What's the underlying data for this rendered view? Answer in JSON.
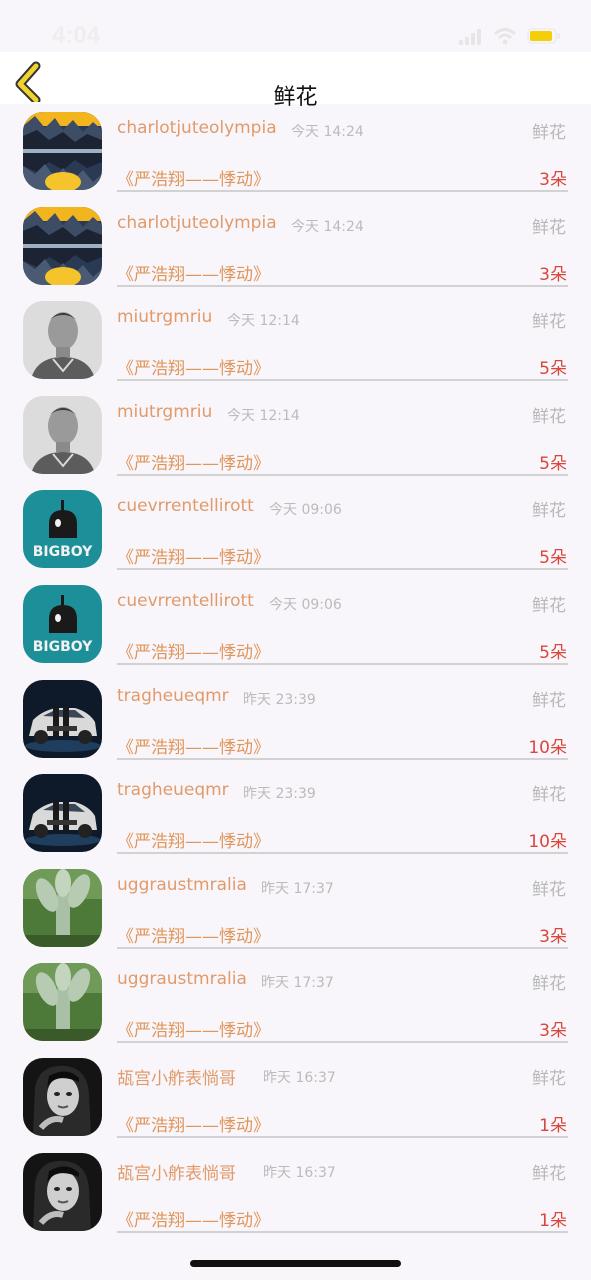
{
  "status_bar": {
    "time": "4:04"
  },
  "header": {
    "title": "鲜花"
  },
  "rows": [
    {
      "avatar": "landscape-avatar",
      "name": "charlotjuteolympia",
      "time": "今天 14:24",
      "gift": "鲜花",
      "song": "《严浩翔——悸动》",
      "count": "3朵"
    },
    {
      "avatar": "landscape-avatar",
      "name": "charlotjuteolympia",
      "time": "今天 14:24",
      "gift": "鲜花",
      "song": "《严浩翔——悸动》",
      "count": "3朵"
    },
    {
      "avatar": "man-portrait-avatar",
      "name": "miutrgmriu",
      "time": "今天 12:14",
      "gift": "鲜花",
      "song": "《严浩翔——悸动》",
      "count": "5朵"
    },
    {
      "avatar": "man-portrait-avatar",
      "name": "miutrgmriu",
      "time": "今天 12:14",
      "gift": "鲜花",
      "song": "《严浩翔——悸动》",
      "count": "5朵"
    },
    {
      "avatar": "bigboy-logo-avatar",
      "name": "cuevrrentellirott",
      "time": "今天 09:06",
      "gift": "鲜花",
      "song": "《严浩翔——悸动》",
      "count": "5朵"
    },
    {
      "avatar": "bigboy-logo-avatar",
      "name": "cuevrrentellirott",
      "time": "今天 09:06",
      "gift": "鲜花",
      "song": "《严浩翔——悸动》",
      "count": "5朵"
    },
    {
      "avatar": "car-avatar",
      "name": "tragheueqmr",
      "time": "昨天 23:39",
      "gift": "鲜花",
      "song": "《严浩翔——悸动》",
      "count": "10朵"
    },
    {
      "avatar": "car-avatar",
      "name": "tragheueqmr",
      "time": "昨天 23:39",
      "gift": "鲜花",
      "song": "《严浩翔——悸动》",
      "count": "10朵"
    },
    {
      "avatar": "cactus-avatar",
      "name": "uggraustmralia",
      "time": "昨天 17:37",
      "gift": "鲜花",
      "song": "《严浩翔——悸动》",
      "count": "3朵"
    },
    {
      "avatar": "cactus-avatar",
      "name": "uggraustmralia",
      "time": "昨天 17:37",
      "gift": "鲜花",
      "song": "《严浩翔——悸动》",
      "count": "3朵"
    },
    {
      "avatar": "woman-portrait-avatar",
      "name": "瓳宫小舴表惝哥",
      "time": "昨天 16:37",
      "gift": "鲜花",
      "song": "《严浩翔——悸动》",
      "count": "1朵"
    },
    {
      "avatar": "woman-portrait-avatar",
      "name": "瓳宫小舴表惝哥",
      "time": "昨天 16:37",
      "gift": "鲜花",
      "song": "《严浩翔——悸动》",
      "count": "1朵"
    }
  ],
  "avatar_art": {
    "landscape-avatar": "<svg viewBox='0 0 79 78'><rect width='79' height='78' fill='#2a3a55'/><rect x='0' y='0' width='79' height='14' fill='#f3b51e'/><polygon points='0,14 12,4 22,16 32,6 40,18 50,8 60,20 70,10 79,18 79,38 0,38' fill='#3d4d66'/><polygon points='0,24 14,18 26,28 40,20 52,30 64,22 79,28 79,38 0,38' fill='#1c2433'/><rect x='0' y='37' width='79' height='4' fill='#9fb0c5'/><polygon points='0,41 79,41 79,50 64,56 52,48 40,58 26,50 14,60 0,54' fill='#1c2433'/><polygon points='0,54 12,62 22,52 32,66 40,56 50,68 60,58 70,70 79,62 79,78 0,78' fill='#4a5a72'/><ellipse cx='40' cy='70' rx='18' ry='10' fill='#f5c32c'/></svg>",
    "man-portrait-avatar": "<svg viewBox='0 0 79 78'><rect width='79' height='78' fill='#dcdcdc'/><ellipse cx='40' cy='30' rx='15' ry='19' fill='#9a9a9a'/><path d='M24 22 Q40 2 56 22 Q50 14 40 14 Q30 14 24 22Z' fill='#3b3b3b'/><rect x='33' y='46' width='14' height='10' fill='#8a8a8a'/><path d='M8 78 Q14 56 40 56 Q66 56 72 78Z' fill='#5c5c5c'/><path d='M30 58 L40 70 L50 58' stroke='#d8d8d8' stroke-width='2' fill='none'/></svg>",
    "bigboy-logo-avatar": "<svg viewBox='0 0 79 78'><rect width='79' height='78' fill='#1d8f98'/><path d='M26 48 L26 34 Q26 20 40 20 Q54 20 54 34 L54 48Z' fill='#1a1a1a'/><rect x='38' y='10' width='3' height='12' fill='#1a1a1a'/><ellipse cx='35' cy='33' rx='3' ry='4' fill='#f2f2f2'/><text x='39.5' y='66' text-anchor='middle' font-family='DejaVu Sans, sans-serif' font-size='14' font-weight='bold' fill='#f2f2f2'>BIGBOY</text></svg>",
    "car-avatar": "<svg viewBox='0 0 79 78'><rect width='79' height='78' fill='#0e1a2a'/><ellipse cx='40' cy='66' rx='38' ry='6' fill='#1f3d5c'/><path d='M6 56 L10 40 Q20 30 34 28 L52 28 Q66 32 72 42 L74 56 Z' fill='#d9d9d9'/><path d='M20 36 L32 30 L52 30 L62 38Z' fill='#3a4654'/><rect x='30' y='28' width='6' height='28' fill='#1a1a1a'/><rect x='40' y='28' width='6' height='28' fill='#1a1a1a'/><circle cx='18' cy='57' r='7' fill='#222'/><circle cx='62' cy='57' r='7' fill='#222'/><rect x='24' y='46' width='30' height='5' fill='#333'/></svg>",
    "cactus-avatar": "<svg viewBox='0 0 79 78'><rect width='79' height='78' fill='#4d7a38'/><rect x='0' y='0' width='79' height='30' fill='#6f9a58'/><rect x='33' y='24' width='14' height='54' rx='6' fill='#a9c0a6'/><ellipse cx='24' cy='26' rx='9' ry='18' fill='#b7cbb2' transform='rotate(-25 24 26)'/><ellipse cx='56' cy='22' rx='9' ry='18' fill='#b7cbb2' transform='rotate(25 56 22)'/><ellipse cx='40' cy='14' rx='8' ry='14' fill='#c3d4bf'/><rect x='0' y='66' width='79' height='12' fill='#3a5a2a'/></svg>",
    "woman-portrait-avatar": "<svg viewBox='0 0 79 78'><rect width='79' height='78' fill='#141414'/><path d='M10 78 L12 30 Q16 6 42 8 Q64 10 66 36 L68 78Z' fill='#2a2a2a'/><ellipse cx='40' cy='38' rx='16' ry='20' fill='#cfcfcf'/><path d='M24 30 Q32 14 56 24 L56 20 Q44 8 26 18Z' fill='#0c0c0c'/><ellipse cx='34' cy='36' rx='3' ry='2' fill='#222'/><ellipse cx='46' cy='36' rx='3' ry='2' fill='#222'/><path d='M35 48 Q40 51 45 48' stroke='#555' stroke-width='2' fill='none'/><path d='M18 70 Q28 58 40 62' stroke='#bdbdbd' stroke-width='6' fill='none'/></svg>"
  }
}
